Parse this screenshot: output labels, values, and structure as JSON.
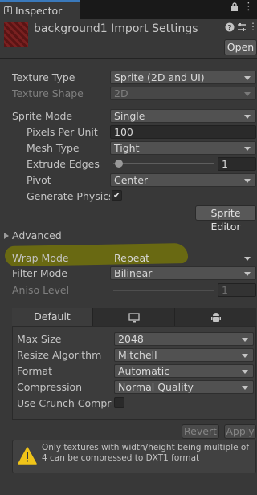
{
  "tab": {
    "title": "Inspector",
    "icon": "i"
  },
  "header": {
    "title": "background1 Import Settings",
    "open_label": "Open"
  },
  "props": {
    "texture_type": {
      "label": "Texture Type",
      "value": "Sprite (2D and UI)"
    },
    "texture_shape": {
      "label": "Texture Shape",
      "value": "2D"
    },
    "sprite_mode": {
      "label": "Sprite Mode",
      "value": "Single"
    },
    "pixels_per_unit": {
      "label": "Pixels Per Unit",
      "value": "100"
    },
    "mesh_type": {
      "label": "Mesh Type",
      "value": "Tight"
    },
    "extrude_edges": {
      "label": "Extrude Edges",
      "value": "1",
      "slider_fraction": 0.03
    },
    "pivot": {
      "label": "Pivot",
      "value": "Center"
    },
    "generate_physics": {
      "label": "Generate Physics S",
      "checked": "✔"
    },
    "sprite_editor_label": "Sprite Editor",
    "advanced_label": "Advanced",
    "wrap_mode": {
      "label": "Wrap Mode",
      "value": "Repeat"
    },
    "filter_mode": {
      "label": "Filter Mode",
      "value": "Bilinear"
    },
    "aniso_level": {
      "label": "Aniso Level",
      "value": "1"
    }
  },
  "platform": {
    "default_tab": "Default",
    "max_size": {
      "label": "Max Size",
      "value": "2048"
    },
    "resize_algorithm": {
      "label": "Resize Algorithm",
      "value": "Mitchell"
    },
    "format": {
      "label": "Format",
      "value": "Automatic"
    },
    "compression": {
      "label": "Compression",
      "value": "Normal Quality"
    },
    "use_crunch": {
      "label": "Use Crunch Compres"
    }
  },
  "buttons": {
    "revert": "Revert",
    "apply": "Apply"
  },
  "warning": {
    "text": "Only textures with width/height being multiple of 4 can be compressed to DXT1 format"
  },
  "colors": {
    "highlight": "#6b6b10",
    "accent": "#3a79bb",
    "background": "#383838"
  }
}
